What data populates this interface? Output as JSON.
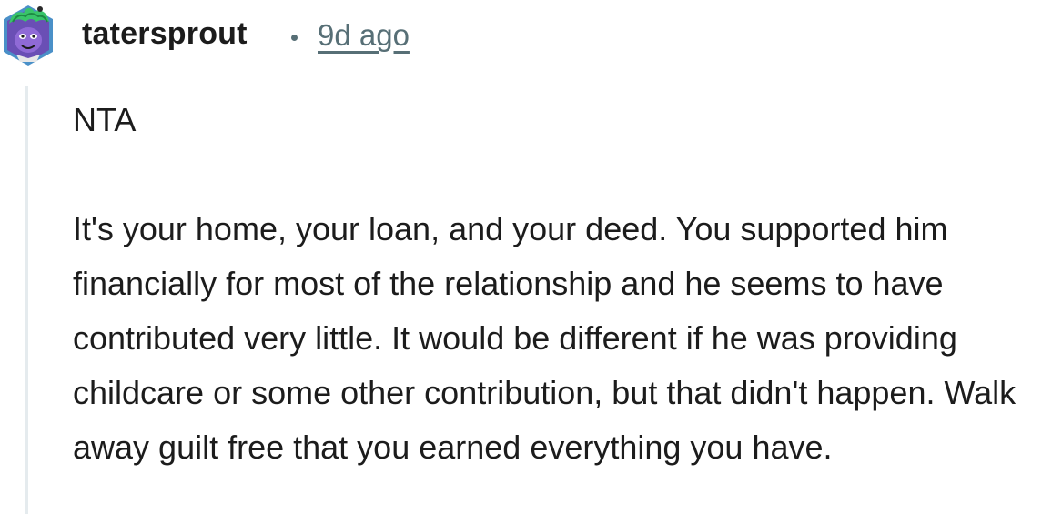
{
  "comment": {
    "author": "tatersprout",
    "timestamp": "9d ago",
    "avatar_icon": "snoo-avatar-icon",
    "paragraphs": [
      "NTA",
      "It's your home, your loan, and your deed. You supported him financially for most of the relationship and he seems to have contributed very little. It would be different if he was providing childcare or some other contribution, but that didn't happen. Walk away guilt free that you earned everything you have."
    ]
  },
  "colors": {
    "meta_text": "#576f76",
    "body_text": "#1c1c1c",
    "thread_line": "#e5ebee",
    "avatar_bg": "#7a5fc4"
  }
}
